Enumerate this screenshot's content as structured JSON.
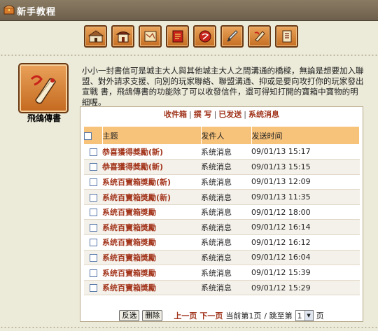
{
  "window": {
    "title": "新手教程"
  },
  "toolbar": {
    "icons": [
      "city-icon",
      "palace-icon",
      "map-icon",
      "flag-icon",
      "scroll-icon",
      "sword-icon",
      "pigeon-letter-icon",
      "book-icon"
    ]
  },
  "feature": {
    "label": "飛鴿傳書",
    "description": "小小一封書信可是城主大人與其他城主大人之間溝通的橋樑，無論是想要加入聯盟、對外請求支援、向別的玩家聯絡、聯盟溝通、抑或是要向攻打你的玩家發出宣戰 書，飛鴿傳書的功能除了可以收發信件，還可得知打開的寶箱中寶物的明細喔。"
  },
  "mail": {
    "nav": {
      "inbox": "收件箱",
      "compose": "撰 写",
      "sent": "已发送",
      "system": "系统消息",
      "separator": "|"
    },
    "columns": {
      "subject": "主题",
      "sender": "发件人",
      "time": "发送时间"
    },
    "rows": [
      {
        "subject": "恭喜獲得獎勵(新)",
        "sender": "系统消息",
        "time": "09/01/13 15:17"
      },
      {
        "subject": "恭喜獲得獎勵(新)",
        "sender": "系统消息",
        "time": "09/01/13 15:15"
      },
      {
        "subject": "系统百寶箱獎勵(新)",
        "sender": "系统消息",
        "time": "09/01/13 12:09"
      },
      {
        "subject": "系统百寶箱獎勵(新)",
        "sender": "系统消息",
        "time": "09/01/13 11:35"
      },
      {
        "subject": "系统百寶箱獎勵",
        "sender": "系统消息",
        "time": "09/01/12 18:00"
      },
      {
        "subject": "系统百寶箱獎勵",
        "sender": "系统消息",
        "time": "09/01/12 16:14"
      },
      {
        "subject": "系统百寶箱獎勵",
        "sender": "系统消息",
        "time": "09/01/12 16:12"
      },
      {
        "subject": "系统百寶箱獎勵",
        "sender": "系统消息",
        "time": "09/01/12 16:04"
      },
      {
        "subject": "系统百寶箱獎勵",
        "sender": "系统消息",
        "time": "09/01/12 15:39"
      },
      {
        "subject": "系统百寶箱獎勵",
        "sender": "系统消息",
        "time": "09/01/12 15:29"
      }
    ],
    "pager": {
      "invert_label": "反选",
      "delete_label": "删除",
      "prev_label": "上一页",
      "next_label": "下一页",
      "current_text": "当前第1页",
      "jump_prefix": "/ 跳至第",
      "jump_value": "1",
      "jump_suffix": "页"
    }
  },
  "colors": {
    "accent": "#a3361d",
    "header": "#f7c27a",
    "titlebar": "#7a6c56",
    "button": "#d98338"
  }
}
